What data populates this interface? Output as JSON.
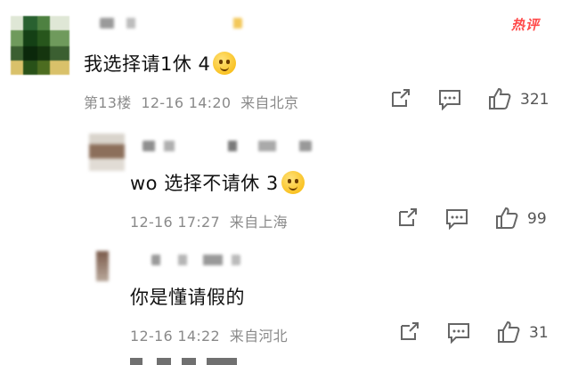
{
  "hot_label": "热评",
  "comments": [
    {
      "text": "我选择请1休 4",
      "floor": "第13楼",
      "time": "12-16 14:20",
      "location": "来自北京",
      "likes": "321"
    },
    {
      "text": "wo 选择不请休 3",
      "time": "12-16 17:27",
      "location": "来自上海",
      "likes": "99"
    },
    {
      "text": "你是懂请假的",
      "time": "12-16 14:22",
      "location": "来自河北",
      "likes": "31"
    }
  ],
  "icons": {
    "share": "share-icon",
    "comment": "comment-icon",
    "like": "thumbs-up-icon"
  }
}
